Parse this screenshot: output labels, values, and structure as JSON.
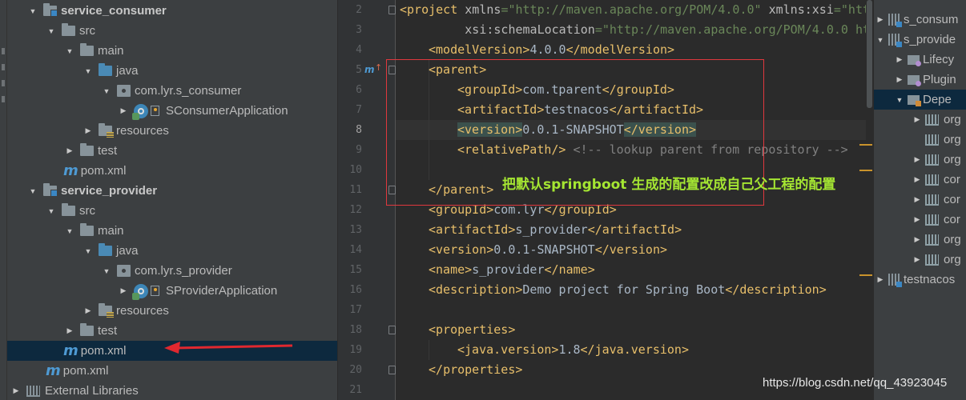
{
  "project_tree": {
    "rows": [
      {
        "label": "service_consumer",
        "bold": true
      },
      {
        "label": "src"
      },
      {
        "label": "main"
      },
      {
        "label": "java"
      },
      {
        "label": "com.lyr.s_consumer"
      },
      {
        "label": "SConsumerApplication"
      },
      {
        "label": "resources"
      },
      {
        "label": "test"
      },
      {
        "label": "pom.xml"
      },
      {
        "label": "service_provider",
        "bold": true
      },
      {
        "label": "src"
      },
      {
        "label": "main"
      },
      {
        "label": "java"
      },
      {
        "label": "com.lyr.s_provider"
      },
      {
        "label": "SProviderApplication"
      },
      {
        "label": "resources"
      },
      {
        "label": "test"
      },
      {
        "label": "pom.xml",
        "selected": true
      },
      {
        "label": "pom.xml"
      },
      {
        "label": "External Libraries"
      }
    ]
  },
  "editor": {
    "line_numbers": [
      "2",
      "3",
      "4",
      "5",
      "6",
      "7",
      "8",
      "9",
      "10",
      "11",
      "12",
      "13",
      "14",
      "15",
      "16",
      "17",
      "18",
      "19",
      "20",
      "21"
    ],
    "current_line": "8",
    "gutter_marker": "m",
    "lines": [
      {
        "a": "<",
        "b": "project",
        "c": " xmlns",
        "d": "=",
        "e": "\"http://maven.apache.org/POM/4.0.0\"",
        "f": " xmlns:xsi",
        "g": "=",
        "h": "\"http"
      },
      {
        "a": "         xsi:schemaLocation",
        "b": "=",
        "c": "\"http://maven.apache.org/POM/4.0.0 htt"
      },
      {
        "open": "modelVersion",
        "text": "4.0.0",
        "close": "modelVersion"
      },
      {
        "open": "parent"
      },
      {
        "open": "groupId",
        "text": "com.tparent",
        "close": "groupId"
      },
      {
        "open": "artifactId",
        "text": "testnacos",
        "close": "artifactId"
      },
      {
        "open": "version",
        "text": "0.0.1-SNAPSHOT",
        "close": "version"
      },
      {
        "open": "relativePath",
        "comment": " <!-- lookup parent from repository -->"
      },
      {},
      {
        "close": "parent"
      },
      {
        "open": "groupId",
        "text": "com.lyr",
        "close": "groupId"
      },
      {
        "open": "artifactId",
        "text": "s_provider",
        "close": "artifactId"
      },
      {
        "open": "version",
        "text": "0.0.1-SNAPSHOT",
        "close": "version"
      },
      {
        "open": "name",
        "text": "s_provider",
        "close": "name"
      },
      {
        "open": "description",
        "text": "Demo project for Spring Boot",
        "close": "description"
      },
      {},
      {
        "open": "properties"
      },
      {
        "open": "java.version",
        "text": "1.8",
        "close": "java.version"
      },
      {
        "close": "properties"
      },
      {}
    ],
    "annotation": "把默认springboot 生成的配置改成自己父工程的配置"
  },
  "maven_panel": {
    "rows": [
      {
        "label": "s_consum"
      },
      {
        "label": "s_provide"
      },
      {
        "label": "Lifecy"
      },
      {
        "label": "Plugin"
      },
      {
        "label": "Depe",
        "selected": true
      },
      {
        "label": "org"
      },
      {
        "label": "org"
      },
      {
        "label": "org"
      },
      {
        "label": "cor"
      },
      {
        "label": "cor"
      },
      {
        "label": "cor"
      },
      {
        "label": "org"
      },
      {
        "label": "org"
      },
      {
        "label": "testnacos"
      }
    ]
  },
  "watermark": "https://blog.csdn.net/qq_43923045",
  "colors": {
    "annotation": "#a5e632",
    "red_box": "#e0383e",
    "arrow": "#e0282f",
    "tag": "#e8bf6a",
    "string": "#6a8759"
  }
}
